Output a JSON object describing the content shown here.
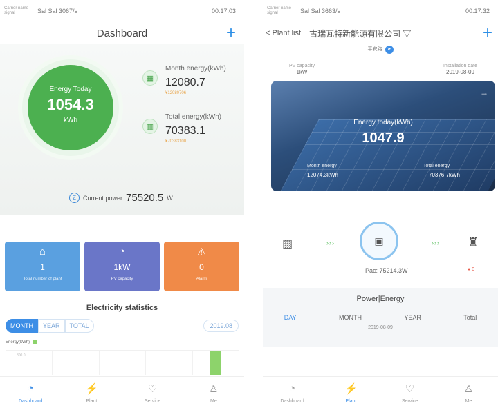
{
  "left": {
    "status": {
      "tiny": "Carrier name signal",
      "network": "Sal Sal 3067/s",
      "right": "00:17:03"
    },
    "header": {
      "title": "Dashboard",
      "plus": "+"
    },
    "today": {
      "label": "Energy Today",
      "value": "1054.3",
      "unit": "kWh"
    },
    "month": {
      "label": "Month energy(kWh)",
      "value": "12080.7",
      "sub": "¥12080706"
    },
    "total": {
      "label": "Total energy(kWh)",
      "value": "70383.1",
      "sub": "¥70383100"
    },
    "power": {
      "label": "Current power",
      "value": "75520.5",
      "unit": "W"
    },
    "cards": [
      {
        "icon": "home-icon",
        "glyph": "⌂",
        "value": "1",
        "label": "Total number of plant",
        "color": "#5aa0e0"
      },
      {
        "icon": "gauge-icon",
        "glyph": "◔",
        "value": "1kW",
        "label": "PV capacity",
        "color": "#6a76c8"
      },
      {
        "icon": "alarm-icon",
        "glyph": "⚠",
        "value": "0",
        "label": "Alarm",
        "color": "#f08a48"
      }
    ],
    "stats": {
      "title": "Electricity statistics",
      "tabs": [
        "MONTH",
        "YEAR",
        "TOTAL"
      ],
      "date": "2019.08",
      "legend": "Energy(kWh)",
      "ytick": "800.0"
    },
    "chart_data": {
      "type": "bar",
      "series": [
        {
          "name": "Energy(kWh)",
          "values": [
            0,
            0,
            0,
            0,
            1054.3
          ]
        }
      ],
      "ylim": [
        0,
        1200
      ]
    }
  },
  "right": {
    "status": {
      "tiny": "Carrier name signal",
      "network": "Sal Sal 3663/s",
      "right": "00:17:32"
    },
    "header": {
      "back": "< Plant list",
      "plant_name": "古瑞瓦特新能源有限公司 ▽",
      "plus": "+"
    },
    "badge": "平安路",
    "capacity": {
      "label": "PV capacity",
      "value": "1kW"
    },
    "install": {
      "label": "Installation date",
      "value": "2019-08-09"
    },
    "banner": {
      "energy_label": "Energy today(kWh)",
      "energy_value": "1047.9",
      "month_label": "Month energy",
      "month_value": "12074.3kWh",
      "total_label": "Total energy",
      "total_value": "70376.7kWh"
    },
    "flow": {
      "pac": "Pac: 75214.3W",
      "alarm": "● 0"
    },
    "power_energy": {
      "title": "Power|Energy",
      "tabs": [
        "DAY",
        "MONTH",
        "YEAR",
        "Total"
      ],
      "date": "2019-08-09"
    }
  },
  "tabbar": [
    {
      "label": "Dashboard",
      "icon": "dashboard-icon",
      "glyph": "◔"
    },
    {
      "label": "Plant",
      "icon": "plant-icon",
      "glyph": "⚡"
    },
    {
      "label": "Service",
      "icon": "service-icon",
      "glyph": "♡"
    },
    {
      "label": "Me",
      "icon": "me-icon",
      "glyph": "♙"
    }
  ]
}
